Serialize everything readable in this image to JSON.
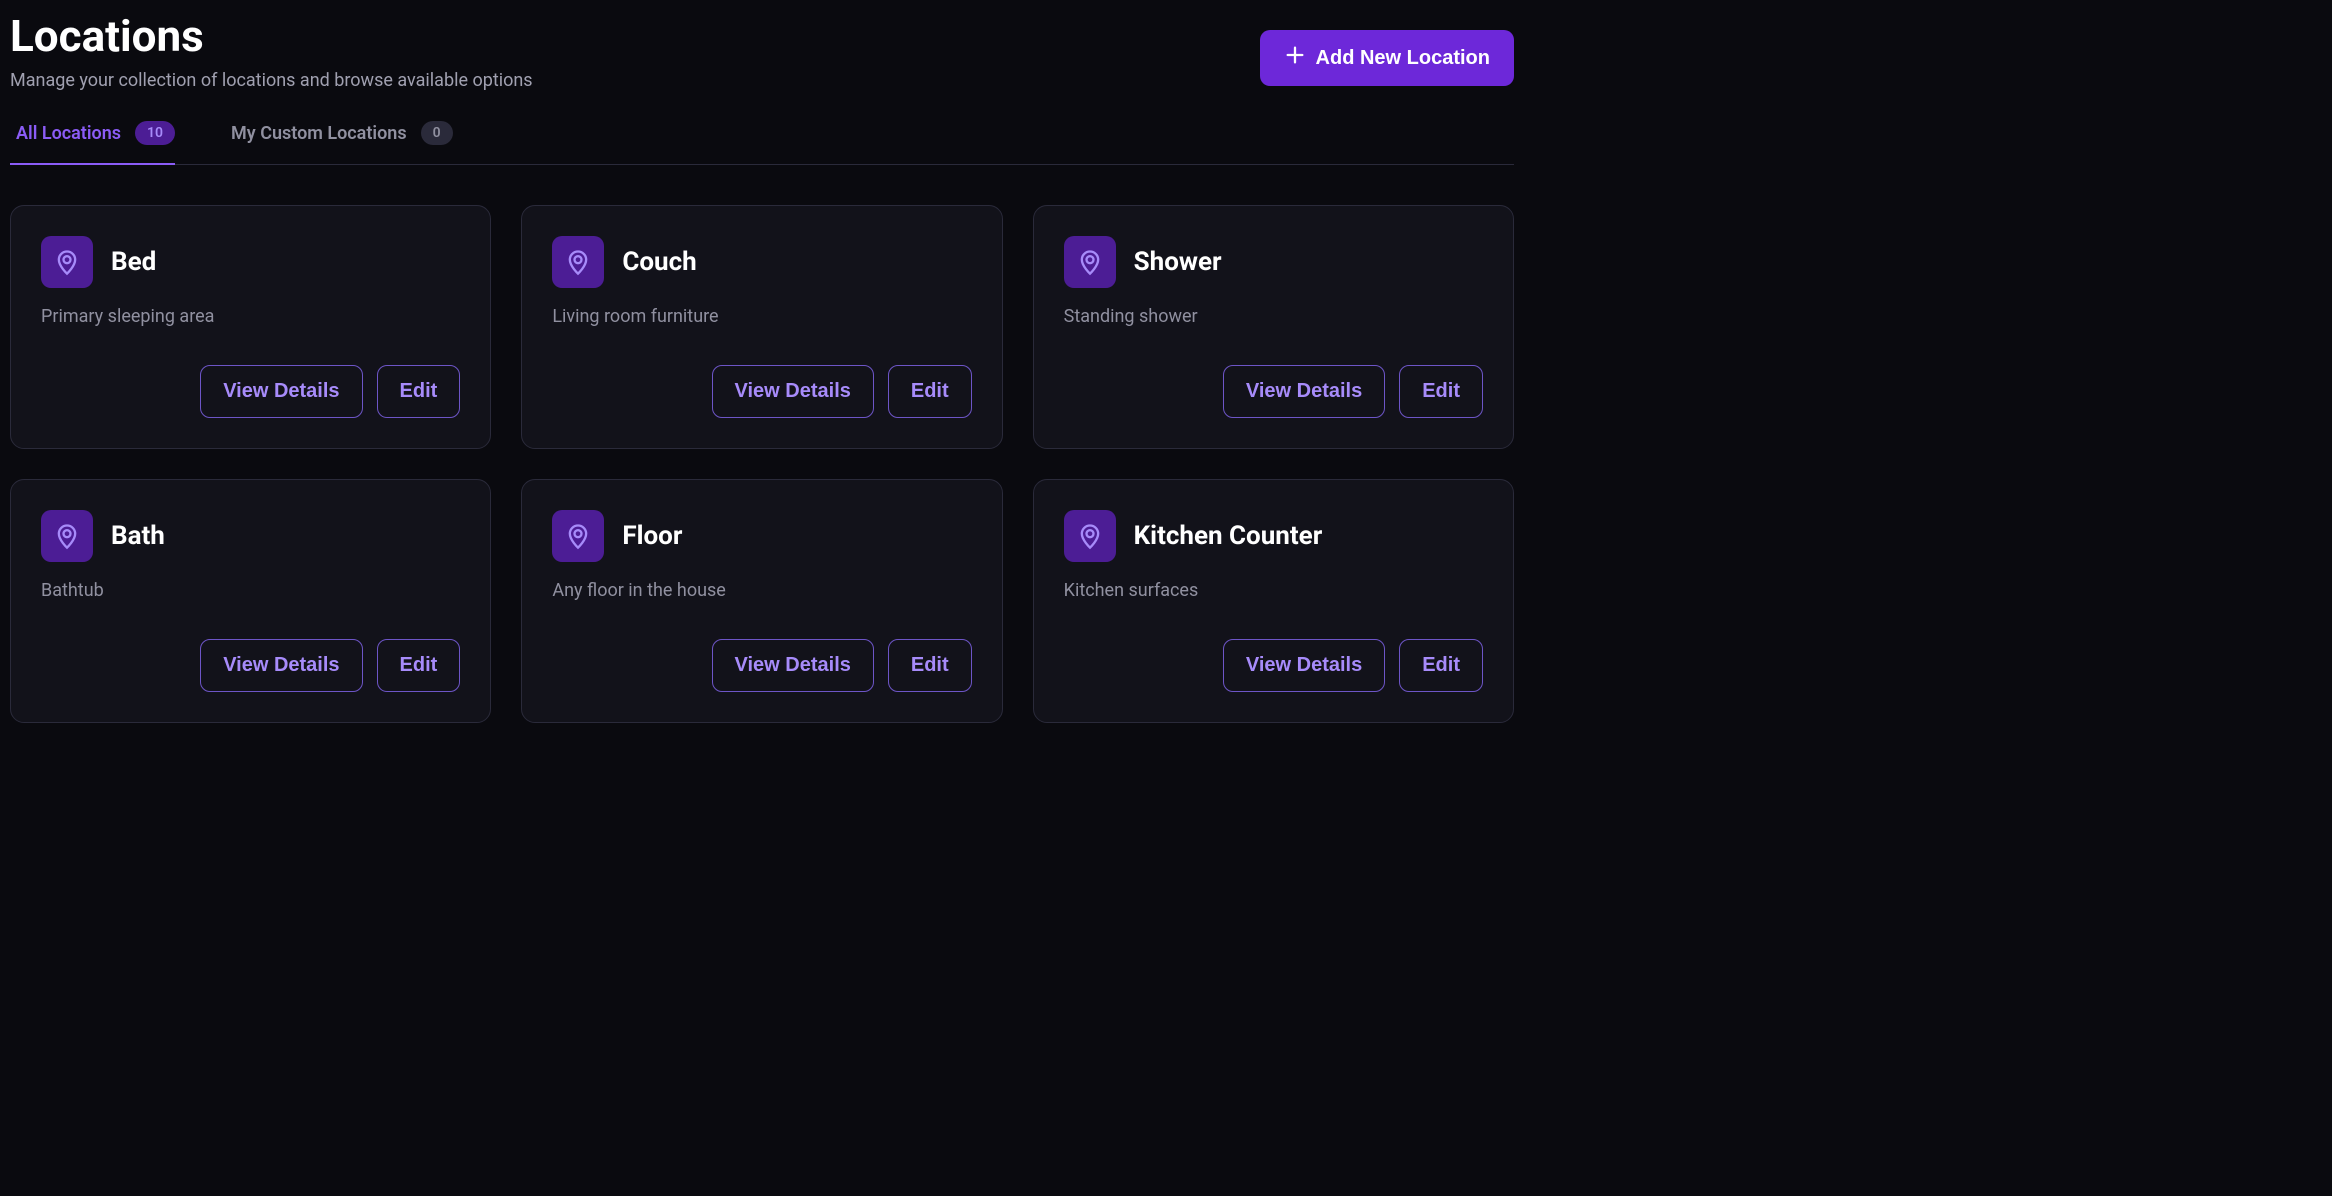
{
  "header": {
    "title": "Locations",
    "subtitle": "Manage your collection of locations and browse available options",
    "addButtonLabel": "Add New Location"
  },
  "tabs": [
    {
      "label": "All Locations",
      "count": "10",
      "active": true
    },
    {
      "label": "My Custom Locations",
      "count": "0",
      "active": false
    }
  ],
  "buttons": {
    "viewDetails": "View Details",
    "edit": "Edit"
  },
  "locations": [
    {
      "name": "Bed",
      "description": "Primary sleeping area"
    },
    {
      "name": "Couch",
      "description": "Living room furniture"
    },
    {
      "name": "Shower",
      "description": "Standing shower"
    },
    {
      "name": "Bath",
      "description": "Bathtub"
    },
    {
      "name": "Floor",
      "description": "Any floor in the house"
    },
    {
      "name": "Kitchen Counter",
      "description": "Kitchen surfaces"
    }
  ]
}
